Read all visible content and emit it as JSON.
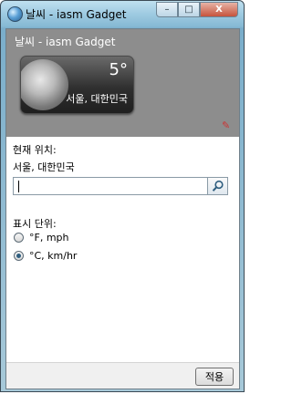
{
  "window": {
    "title": "날씨 - iasm Gadget",
    "controls": {
      "minimize": "–",
      "maximize": "□",
      "close": "X"
    }
  },
  "gadget": {
    "header": "날씨 - iasm Gadget",
    "temperature": "5°",
    "location": "서울, 대한민국",
    "settings_icon": "wrench-icon"
  },
  "options": {
    "current_location_label": "현재 위치:",
    "current_location_value": "서울, 대한민국",
    "search": {
      "value": "",
      "placeholder": ""
    },
    "units_label": "표시 단위:",
    "units": [
      {
        "label": "°F, mph",
        "checked": false
      },
      {
        "label": "°C, km/hr",
        "checked": true
      }
    ],
    "apply_label": "적용"
  },
  "colors": {
    "gadget_bg": "#8d8d8d",
    "accent": "#2f5e7f"
  }
}
